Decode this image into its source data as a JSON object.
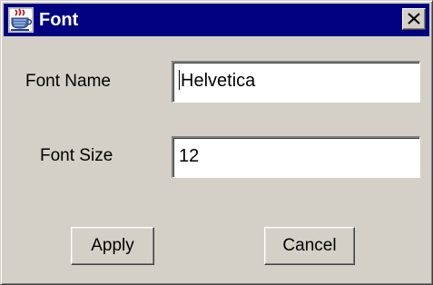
{
  "window": {
    "title": "Font",
    "icon": "java-coffee-cup-icon",
    "close_icon": "close-x-icon"
  },
  "form": {
    "font_name_label": "Font Name",
    "font_name_value": "Helvetica",
    "font_size_label": "Font Size",
    "font_size_value": "12"
  },
  "buttons": {
    "apply_label": "Apply",
    "cancel_label": "Cancel"
  },
  "colors": {
    "titlebar": "#000080",
    "title_text": "#ffffff",
    "dialog_face": "#d4d0c8",
    "field_background": "#ffffff"
  }
}
